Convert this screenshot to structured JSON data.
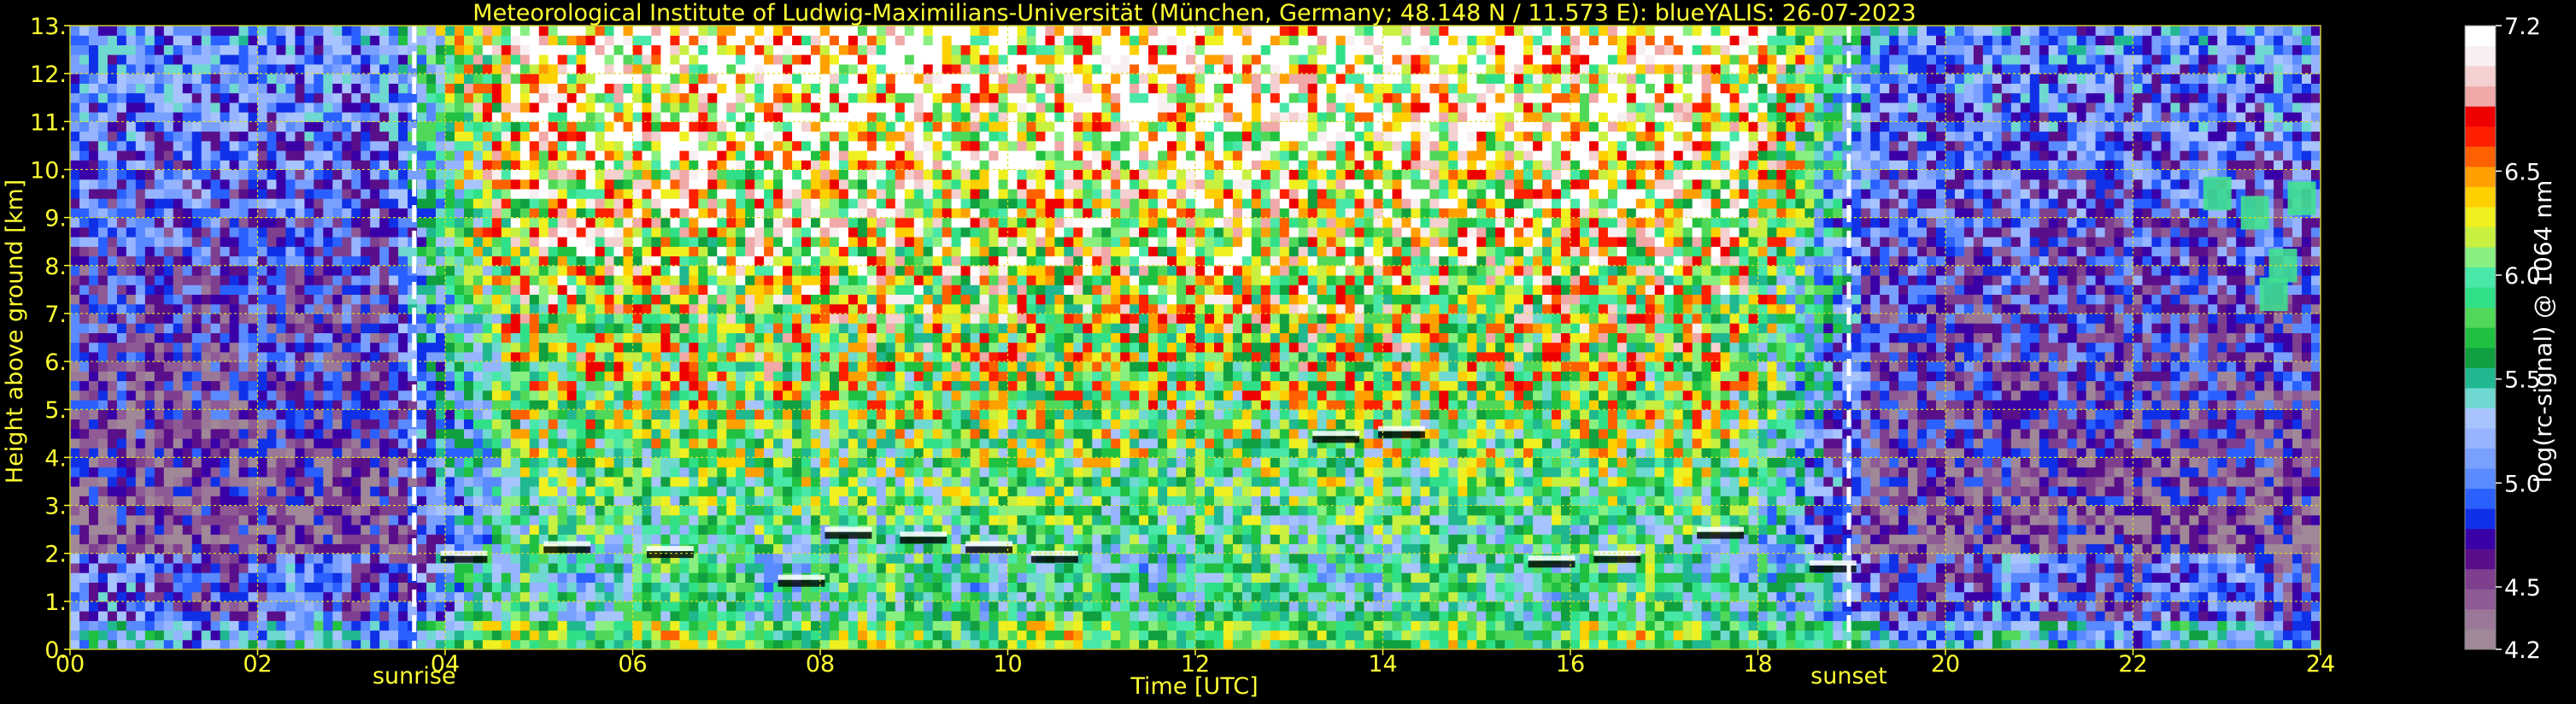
{
  "chart_data": {
    "type": "heatmap",
    "title": "Meteorological Institute of Ludwig-Maximilians-Universität (München, Germany; 48.148 N / 11.573 E):    blueYALIS: 26-07-2023",
    "xlabel": "Time [UTC]",
    "ylabel": "Height above ground [km]",
    "xlim": [
      0,
      24
    ],
    "ylim": [
      0,
      13
    ],
    "x_ticks": [
      "00",
      "02",
      "04",
      "06",
      "08",
      "10",
      "12",
      "14",
      "16",
      "18",
      "20",
      "22",
      "24"
    ],
    "y_ticks": [
      "0.",
      "1.",
      "2.",
      "3.",
      "4.",
      "5.",
      "6.",
      "7.",
      "8.",
      "9.",
      "10.",
      "11.",
      "12.",
      "13."
    ],
    "grid": true,
    "markers": [
      {
        "label": "sunrise",
        "time_utc": 3.67
      },
      {
        "label": "sunset",
        "time_utc": 18.97
      }
    ],
    "colorbar": {
      "label": "log(rc-signal) @ 1064 nm",
      "range": [
        4.2,
        7.2
      ],
      "ticks": [
        "4.2",
        "4.5",
        "5.0",
        "5.5",
        "6.0",
        "6.5",
        "7.2"
      ],
      "colors": [
        "#a08898",
        "#9b7898",
        "#8f5a95",
        "#7f3f8f",
        "#5a0f8a",
        "#3a00a8",
        "#1030e8",
        "#2a60ff",
        "#5a8aff",
        "#7aa0ff",
        "#96b4ff",
        "#a8c4ff",
        "#6fd8d0",
        "#20b890",
        "#10a040",
        "#20c040",
        "#50d858",
        "#30e088",
        "#48e8a8",
        "#88f080",
        "#c8f040",
        "#f0f020",
        "#ffd000",
        "#ffa000",
        "#ff6000",
        "#ff2000",
        "#ee0000",
        "#f0a8a8",
        "#f4d0d0",
        "#f8f0f0",
        "#ffffff"
      ]
    }
  }
}
